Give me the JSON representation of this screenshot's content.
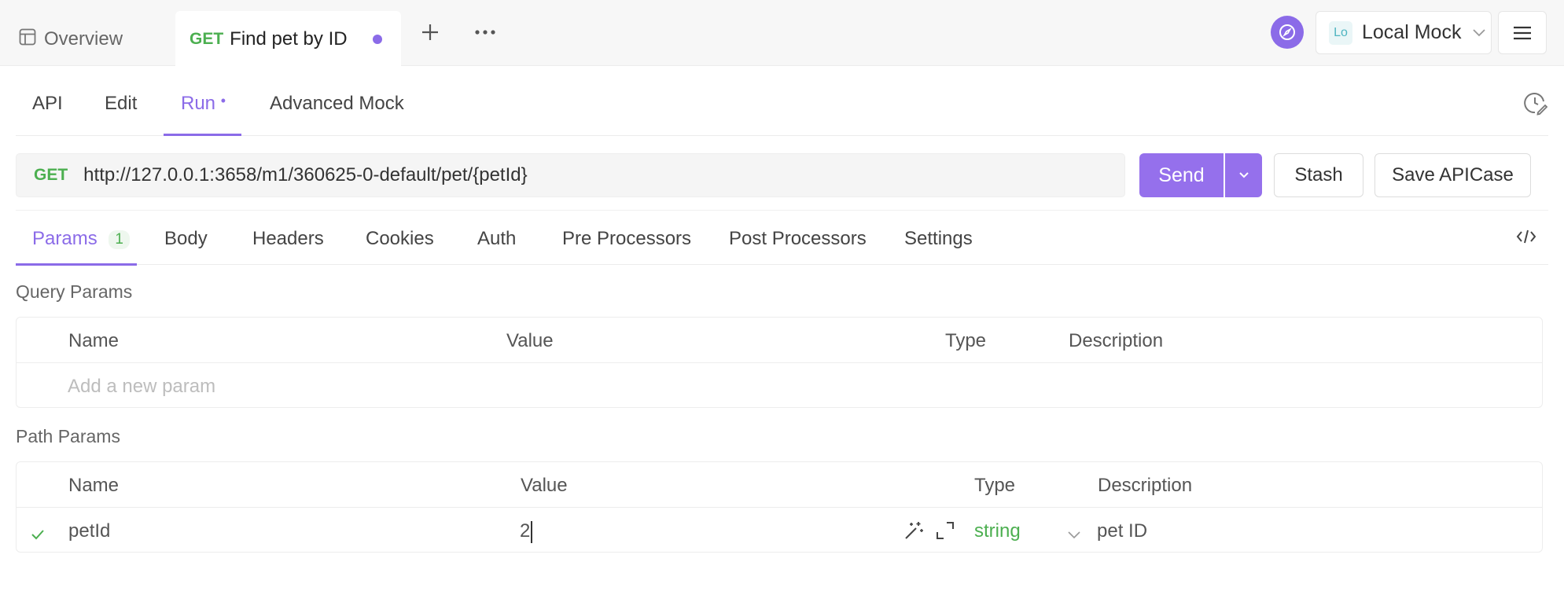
{
  "topbar": {
    "overview_label": "Overview",
    "active_tab": {
      "method": "GET",
      "title": "Find pet by ID"
    },
    "environment": {
      "badge": "Lo",
      "name": "Local Mock"
    }
  },
  "subtabs": {
    "items": [
      "API",
      "Edit",
      "Run",
      "Advanced Mock"
    ],
    "active": "Run",
    "run_dot": "•"
  },
  "request": {
    "method": "GET",
    "url": "http://127.0.0.1:3658/m1/360625-0-default/pet/{petId}",
    "send_label": "Send",
    "stash_label": "Stash",
    "save_label": "Save APICase"
  },
  "reqtabs": {
    "items": [
      "Params",
      "Body",
      "Headers",
      "Cookies",
      "Auth",
      "Pre Processors",
      "Post Processors",
      "Settings"
    ],
    "params_count": "1"
  },
  "query_params": {
    "title": "Query Params",
    "columns": [
      "Name",
      "Value",
      "Type",
      "Description"
    ],
    "placeholder": "Add a new param"
  },
  "path_params": {
    "title": "Path Params",
    "columns": [
      "Name",
      "Value",
      "Type",
      "Description"
    ],
    "rows": [
      {
        "name": "petId",
        "value": "2",
        "type": "string",
        "description": "pet ID"
      }
    ]
  },
  "colors": {
    "accent": "#8b6be8",
    "get": "#4caf50"
  }
}
